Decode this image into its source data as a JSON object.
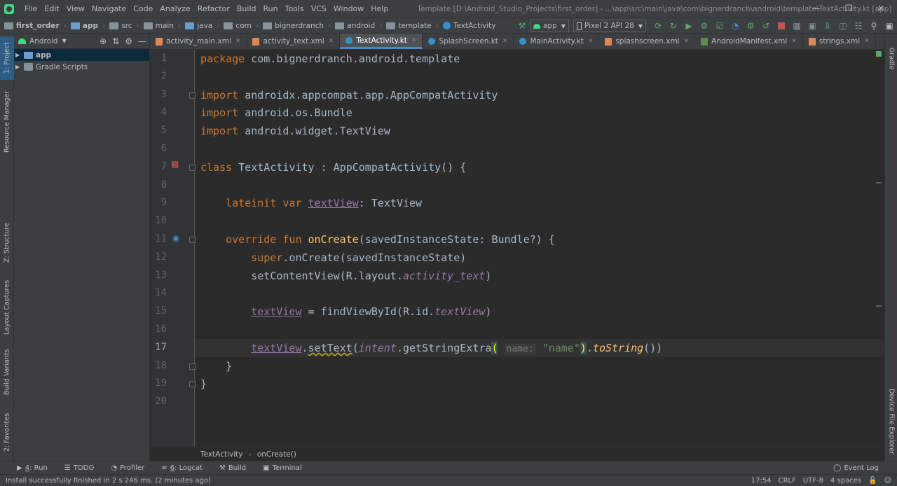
{
  "menu": {
    "items": [
      "File",
      "Edit",
      "View",
      "Navigate",
      "Code",
      "Analyze",
      "Refactor",
      "Build",
      "Run",
      "Tools",
      "VCS",
      "Window",
      "Help"
    ],
    "window_title": "Template [D:\\Android_Studio_Projects\\first_order] - ...\\app\\src\\main\\java\\com\\bignerdranch\\android\\template\\TextActivity.kt [app]"
  },
  "navbar": {
    "crumbs": [
      "first_order",
      "app",
      "src",
      "main",
      "java",
      "com",
      "bignerdranch",
      "android",
      "template",
      "TextActivity"
    ],
    "run_config": "app",
    "device": "Pixel 2 API 28"
  },
  "left_tabs": {
    "project": "1: Project",
    "resource_manager": "Resource Manager",
    "structure": "Z: Structure",
    "layout_captures": "Layout Captures",
    "build_variants": "Build Variants",
    "favorites": "2: Favorites"
  },
  "right_tabs": {
    "gradle": "Gradle",
    "device_file_explorer": "Device File Explorer"
  },
  "project_panel": {
    "view": "Android",
    "tree": [
      {
        "label": "app",
        "selected": true
      },
      {
        "label": "Gradle Scripts",
        "selected": false
      }
    ]
  },
  "editor_tabs": [
    {
      "label": "activity_main.xml",
      "icon": "xml-file-icon",
      "active": false
    },
    {
      "label": "activity_text.xml",
      "icon": "xml-file-icon",
      "active": false
    },
    {
      "label": "TextActivity.kt",
      "icon": "kotlin-file-icon",
      "active": true
    },
    {
      "label": "SplashScreen.kt",
      "icon": "kotlin-file-icon",
      "active": false
    },
    {
      "label": "MainActivity.kt",
      "icon": "kotlin-file-icon",
      "active": false
    },
    {
      "label": "splashscreen.xml",
      "icon": "xml-file-icon",
      "active": false
    },
    {
      "label": "AndroidManifest.xml",
      "icon": "manifest-file-icon",
      "active": false
    },
    {
      "label": "strings.xml",
      "icon": "xml-file-icon",
      "active": false
    }
  ],
  "code": {
    "current_line": 17,
    "lines": [
      [
        [
          "kw",
          "package"
        ],
        [
          "plain",
          " com.bignerdranch.android.template"
        ]
      ],
      [],
      [
        [
          "kw",
          "import"
        ],
        [
          "plain",
          " androidx.appcompat.app.AppCompatActivity"
        ]
      ],
      [
        [
          "kw",
          "import"
        ],
        [
          "plain",
          " android.os.Bundle"
        ]
      ],
      [
        [
          "kw",
          "import"
        ],
        [
          "plain",
          " android.widget.TextView"
        ]
      ],
      [],
      [
        [
          "kw",
          "class"
        ],
        [
          "plain",
          " TextActivity : AppCompatActivity() {"
        ]
      ],
      [],
      [
        [
          "plain",
          "    "
        ],
        [
          "kw",
          "lateinit var "
        ],
        [
          "prop",
          "textView"
        ],
        [
          "plain",
          ": TextView"
        ]
      ],
      [],
      [
        [
          "plain",
          "    "
        ],
        [
          "kw",
          "override fun "
        ],
        [
          "fn",
          "onCreate"
        ],
        [
          "plain",
          "(savedInstanceState: Bundle?) {"
        ]
      ],
      [
        [
          "plain",
          "        "
        ],
        [
          "kw",
          "super"
        ],
        [
          "plain",
          ".onCreate(savedInstanceState)"
        ]
      ],
      [
        [
          "plain",
          "        setContentView(R.layout."
        ],
        [
          "iprop",
          "activity_text"
        ],
        [
          "plain",
          ")"
        ]
      ],
      [],
      [
        [
          "plain",
          "        "
        ],
        [
          "prop",
          "textView"
        ],
        [
          "plain",
          " = findViewById(R.id."
        ],
        [
          "iprop",
          "textView"
        ],
        [
          "plain",
          ")"
        ]
      ],
      [],
      [
        [
          "plain",
          "        "
        ],
        [
          "prop",
          "textView"
        ],
        [
          "plain",
          "."
        ],
        [
          "warn",
          "setText"
        ],
        [
          "plain",
          "("
        ],
        [
          "iprop",
          "intent"
        ],
        [
          "plain",
          ".getStringExtra"
        ],
        [
          "paren",
          "("
        ],
        [
          "plain",
          " "
        ],
        [
          "hint",
          "name:"
        ],
        [
          "plain",
          " "
        ],
        [
          "str",
          "\"name\""
        ],
        [
          "paren",
          ")"
        ],
        [
          "plain",
          "."
        ],
        [
          "ifn",
          "toString"
        ],
        [
          "plain",
          "())"
        ]
      ],
      [
        [
          "plain",
          "    }"
        ]
      ],
      [
        [
          "plain",
          "}"
        ]
      ],
      []
    ]
  },
  "code_crumbs": [
    "TextActivity",
    "onCreate()"
  ],
  "bottom_tabs": [
    {
      "key": "4",
      "label": ": Run",
      "icon": "run-icon"
    },
    {
      "key": "",
      "label": "TODO",
      "icon": "todo-icon"
    },
    {
      "key": "",
      "label": "Profiler",
      "icon": "profiler-icon"
    },
    {
      "key": "6",
      "label": ": Logcat",
      "icon": "logcat-icon"
    },
    {
      "key": "",
      "label": "Build",
      "icon": "build-icon"
    },
    {
      "key": "",
      "label": "Terminal",
      "icon": "terminal-icon"
    }
  ],
  "event_log": "Event Log",
  "status": {
    "message": "Install successfully finished in 2 s 246 ms. (2 minutes ago)",
    "position": "17:54",
    "line_sep": "CRLF",
    "encoding": "UTF-8",
    "indent": "4 spaces"
  }
}
